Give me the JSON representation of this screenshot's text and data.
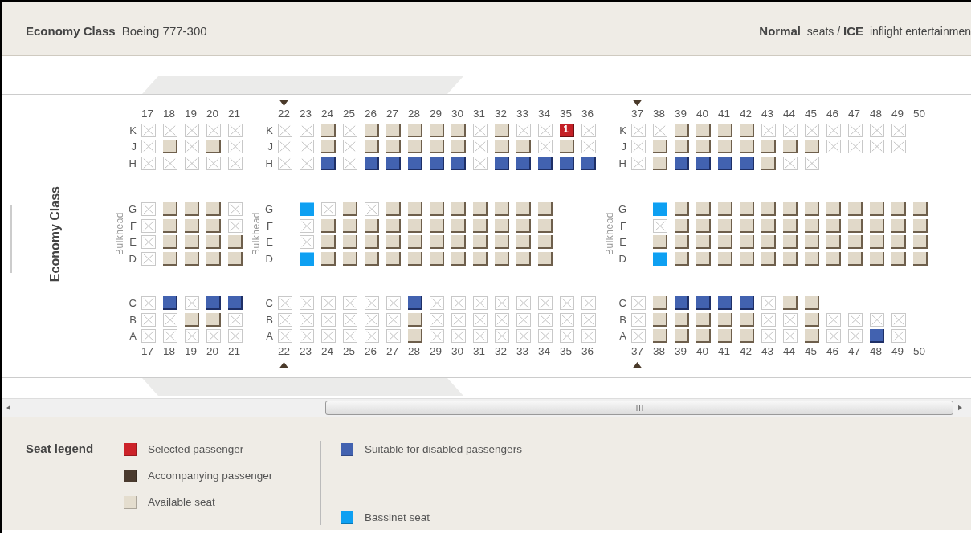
{
  "header": {
    "class_name": "Economy Class",
    "aircraft": "Boeing 777-300",
    "view_modes": "**Normal** seats / **ICE** inflight entertainmen"
  },
  "cabin_label": "Economy Class",
  "sections": [
    {
      "bulkhead": "Bulkhead",
      "top_numbers": [
        "17",
        "18",
        "19",
        "20",
        "21"
      ],
      "bottom_numbers": [
        "17",
        "18",
        "19",
        "20",
        "21"
      ],
      "groups": [
        [
          {
            "letter": "K",
            "seats": [
              {
                "kind": "taken"
              },
              {
                "kind": "taken"
              },
              {
                "kind": "taken"
              },
              {
                "kind": "taken"
              },
              {
                "kind": "taken"
              }
            ]
          },
          {
            "letter": "J",
            "seats": [
              {
                "kind": "taken"
              },
              {
                "kind": "free"
              },
              {
                "kind": "taken"
              },
              {
                "kind": "free"
              },
              {
                "kind": "taken"
              }
            ]
          },
          {
            "letter": "H",
            "seats": [
              {
                "kind": "taken"
              },
              {
                "kind": "taken"
              },
              {
                "kind": "taken"
              },
              {
                "kind": "taken"
              },
              {
                "kind": "taken"
              }
            ]
          }
        ],
        [
          {
            "letter": "G",
            "seats": [
              {
                "kind": "taken"
              },
              {
                "kind": "free"
              },
              {
                "kind": "free"
              },
              {
                "kind": "free"
              },
              {
                "kind": "taken"
              }
            ]
          },
          {
            "letter": "F",
            "seats": [
              {
                "kind": "taken"
              },
              {
                "kind": "free"
              },
              {
                "kind": "free"
              },
              {
                "kind": "free"
              },
              {
                "kind": "taken"
              }
            ]
          },
          {
            "letter": "E",
            "seats": [
              {
                "kind": "taken"
              },
              {
                "kind": "free"
              },
              {
                "kind": "free"
              },
              {
                "kind": "free"
              },
              {
                "kind": "free"
              }
            ]
          },
          {
            "letter": "D",
            "seats": [
              {
                "kind": "taken"
              },
              {
                "kind": "free"
              },
              {
                "kind": "free"
              },
              {
                "kind": "free"
              },
              {
                "kind": "free"
              }
            ]
          }
        ],
        [
          {
            "letter": "C",
            "seats": [
              {
                "kind": "taken"
              },
              {
                "kind": "disabled"
              },
              {
                "kind": "taken"
              },
              {
                "kind": "disabled"
              },
              {
                "kind": "disabled"
              }
            ]
          },
          {
            "letter": "B",
            "seats": [
              {
                "kind": "taken"
              },
              {
                "kind": "taken"
              },
              {
                "kind": "free"
              },
              {
                "kind": "free"
              },
              {
                "kind": "taken"
              }
            ]
          },
          {
            "letter": "A",
            "seats": [
              {
                "kind": "taken"
              },
              {
                "kind": "taken"
              },
              {
                "kind": "taken"
              },
              {
                "kind": "taken"
              },
              {
                "kind": "taken"
              }
            ]
          }
        ]
      ]
    },
    {
      "exit_markers": true,
      "bulkhead": "Bulkhead",
      "top_numbers": [
        "22",
        "23",
        "24",
        "25",
        "26",
        "27",
        "28",
        "29",
        "30",
        "31",
        "32",
        "33",
        "34",
        "35",
        "36"
      ],
      "bottom_numbers": [
        "22",
        "23",
        "24",
        "25",
        "26",
        "27",
        "28",
        "29",
        "30",
        "31",
        "32",
        "33",
        "34",
        "35",
        "36"
      ],
      "groups": [
        [
          {
            "letter": "K",
            "seats": [
              {
                "kind": "taken"
              },
              {
                "kind": "taken"
              },
              {
                "kind": "free"
              },
              {
                "kind": "taken"
              },
              {
                "kind": "free"
              },
              {
                "kind": "free"
              },
              {
                "kind": "free"
              },
              {
                "kind": "free"
              },
              {
                "kind": "free"
              },
              {
                "kind": "taken"
              },
              {
                "kind": "free"
              },
              {
                "kind": "taken"
              },
              {
                "kind": "taken"
              },
              {
                "kind": "selected",
                "label": "1"
              },
              {
                "kind": "taken"
              }
            ]
          },
          {
            "letter": "J",
            "seats": [
              {
                "kind": "taken"
              },
              {
                "kind": "taken"
              },
              {
                "kind": "free"
              },
              {
                "kind": "taken"
              },
              {
                "kind": "free"
              },
              {
                "kind": "free"
              },
              {
                "kind": "free"
              },
              {
                "kind": "free"
              },
              {
                "kind": "free"
              },
              {
                "kind": "taken"
              },
              {
                "kind": "free"
              },
              {
                "kind": "free"
              },
              {
                "kind": "taken"
              },
              {
                "kind": "free"
              },
              {
                "kind": "taken"
              }
            ]
          },
          {
            "letter": "H",
            "seats": [
              {
                "kind": "taken"
              },
              {
                "kind": "taken"
              },
              {
                "kind": "disabled"
              },
              {
                "kind": "taken"
              },
              {
                "kind": "disabled"
              },
              {
                "kind": "disabled"
              },
              {
                "kind": "disabled"
              },
              {
                "kind": "disabled"
              },
              {
                "kind": "disabled"
              },
              {
                "kind": "taken"
              },
              {
                "kind": "disabled"
              },
              {
                "kind": "disabled"
              },
              {
                "kind": "disabled"
              },
              {
                "kind": "disabled"
              },
              {
                "kind": "disabled"
              }
            ]
          }
        ],
        [
          {
            "letter": "G",
            "seats": [
              {
                "kind": "gap"
              },
              {
                "kind": "bassinet"
              },
              {
                "kind": "taken"
              },
              {
                "kind": "free"
              },
              {
                "kind": "taken"
              },
              {
                "kind": "free"
              },
              {
                "kind": "free"
              },
              {
                "kind": "free"
              },
              {
                "kind": "free"
              },
              {
                "kind": "free"
              },
              {
                "kind": "free"
              },
              {
                "kind": "free"
              },
              {
                "kind": "free"
              },
              {
                "kind": "gap"
              },
              {
                "kind": "gap"
              }
            ]
          },
          {
            "letter": "F",
            "seats": [
              {
                "kind": "gap"
              },
              {
                "kind": "taken"
              },
              {
                "kind": "free"
              },
              {
                "kind": "free"
              },
              {
                "kind": "free"
              },
              {
                "kind": "free"
              },
              {
                "kind": "free"
              },
              {
                "kind": "free"
              },
              {
                "kind": "free"
              },
              {
                "kind": "free"
              },
              {
                "kind": "free"
              },
              {
                "kind": "free"
              },
              {
                "kind": "free"
              },
              {
                "kind": "gap"
              },
              {
                "kind": "gap"
              }
            ]
          },
          {
            "letter": "E",
            "seats": [
              {
                "kind": "gap"
              },
              {
                "kind": "taken"
              },
              {
                "kind": "free"
              },
              {
                "kind": "free"
              },
              {
                "kind": "free"
              },
              {
                "kind": "free"
              },
              {
                "kind": "free"
              },
              {
                "kind": "free"
              },
              {
                "kind": "free"
              },
              {
                "kind": "free"
              },
              {
                "kind": "free"
              },
              {
                "kind": "free"
              },
              {
                "kind": "free"
              },
              {
                "kind": "gap"
              },
              {
                "kind": "gap"
              }
            ]
          },
          {
            "letter": "D",
            "seats": [
              {
                "kind": "gap"
              },
              {
                "kind": "bassinet"
              },
              {
                "kind": "free"
              },
              {
                "kind": "free"
              },
              {
                "kind": "free"
              },
              {
                "kind": "free"
              },
              {
                "kind": "free"
              },
              {
                "kind": "free"
              },
              {
                "kind": "free"
              },
              {
                "kind": "free"
              },
              {
                "kind": "free"
              },
              {
                "kind": "free"
              },
              {
                "kind": "free"
              },
              {
                "kind": "gap"
              },
              {
                "kind": "gap"
              }
            ]
          }
        ],
        [
          {
            "letter": "C",
            "seats": [
              {
                "kind": "taken"
              },
              {
                "kind": "taken"
              },
              {
                "kind": "taken"
              },
              {
                "kind": "taken"
              },
              {
                "kind": "taken"
              },
              {
                "kind": "taken"
              },
              {
                "kind": "disabled"
              },
              {
                "kind": "taken"
              },
              {
                "kind": "taken"
              },
              {
                "kind": "taken"
              },
              {
                "kind": "taken"
              },
              {
                "kind": "taken"
              },
              {
                "kind": "taken"
              },
              {
                "kind": "taken"
              },
              {
                "kind": "taken"
              }
            ]
          },
          {
            "letter": "B",
            "seats": [
              {
                "kind": "taken"
              },
              {
                "kind": "taken"
              },
              {
                "kind": "taken"
              },
              {
                "kind": "taken"
              },
              {
                "kind": "taken"
              },
              {
                "kind": "taken"
              },
              {
                "kind": "free"
              },
              {
                "kind": "taken"
              },
              {
                "kind": "taken"
              },
              {
                "kind": "taken"
              },
              {
                "kind": "taken"
              },
              {
                "kind": "taken"
              },
              {
                "kind": "taken"
              },
              {
                "kind": "taken"
              },
              {
                "kind": "taken"
              }
            ]
          },
          {
            "letter": "A",
            "seats": [
              {
                "kind": "taken"
              },
              {
                "kind": "taken"
              },
              {
                "kind": "taken"
              },
              {
                "kind": "taken"
              },
              {
                "kind": "taken"
              },
              {
                "kind": "taken"
              },
              {
                "kind": "free"
              },
              {
                "kind": "taken"
              },
              {
                "kind": "taken"
              },
              {
                "kind": "taken"
              },
              {
                "kind": "taken"
              },
              {
                "kind": "taken"
              },
              {
                "kind": "taken"
              },
              {
                "kind": "taken"
              },
              {
                "kind": "taken"
              }
            ]
          }
        ]
      ]
    },
    {
      "exit_markers": true,
      "bulkhead": "Bulkhead",
      "top_numbers": [
        "37",
        "38",
        "39",
        "40",
        "41",
        "42",
        "43",
        "44",
        "45",
        "46",
        "47",
        "48",
        "49",
        "50"
      ],
      "bottom_numbers": [
        "37",
        "38",
        "39",
        "40",
        "41",
        "42",
        "43",
        "44",
        "45",
        "46",
        "47",
        "48",
        "49",
        "50"
      ],
      "groups": [
        [
          {
            "letter": "K",
            "seats": [
              {
                "kind": "taken"
              },
              {
                "kind": "taken"
              },
              {
                "kind": "free"
              },
              {
                "kind": "free"
              },
              {
                "kind": "free"
              },
              {
                "kind": "free"
              },
              {
                "kind": "taken"
              },
              {
                "kind": "taken"
              },
              {
                "kind": "taken"
              },
              {
                "kind": "taken"
              },
              {
                "kind": "taken"
              },
              {
                "kind": "taken"
              },
              {
                "kind": "taken"
              },
              {
                "kind": "gap"
              }
            ]
          },
          {
            "letter": "J",
            "seats": [
              {
                "kind": "taken"
              },
              {
                "kind": "free"
              },
              {
                "kind": "free"
              },
              {
                "kind": "free"
              },
              {
                "kind": "free"
              },
              {
                "kind": "free"
              },
              {
                "kind": "free"
              },
              {
                "kind": "free"
              },
              {
                "kind": "free"
              },
              {
                "kind": "taken"
              },
              {
                "kind": "taken"
              },
              {
                "kind": "taken"
              },
              {
                "kind": "taken"
              },
              {
                "kind": "gap"
              }
            ]
          },
          {
            "letter": "H",
            "seats": [
              {
                "kind": "taken"
              },
              {
                "kind": "free"
              },
              {
                "kind": "disabled"
              },
              {
                "kind": "disabled"
              },
              {
                "kind": "disabled"
              },
              {
                "kind": "disabled"
              },
              {
                "kind": "free"
              },
              {
                "kind": "taken"
              },
              {
                "kind": "taken"
              },
              {
                "kind": "gap"
              },
              {
                "kind": "gap"
              },
              {
                "kind": "gap"
              },
              {
                "kind": "gap"
              },
              {
                "kind": "gap"
              }
            ]
          }
        ],
        [
          {
            "letter": "G",
            "seats": [
              {
                "kind": "gap"
              },
              {
                "kind": "bassinet"
              },
              {
                "kind": "free"
              },
              {
                "kind": "free"
              },
              {
                "kind": "free"
              },
              {
                "kind": "free"
              },
              {
                "kind": "free"
              },
              {
                "kind": "free"
              },
              {
                "kind": "free"
              },
              {
                "kind": "free"
              },
              {
                "kind": "free"
              },
              {
                "kind": "free"
              },
              {
                "kind": "free"
              },
              {
                "kind": "free"
              }
            ]
          },
          {
            "letter": "F",
            "seats": [
              {
                "kind": "gap"
              },
              {
                "kind": "taken"
              },
              {
                "kind": "free"
              },
              {
                "kind": "free"
              },
              {
                "kind": "free"
              },
              {
                "kind": "free"
              },
              {
                "kind": "free"
              },
              {
                "kind": "free"
              },
              {
                "kind": "free"
              },
              {
                "kind": "free"
              },
              {
                "kind": "free"
              },
              {
                "kind": "free"
              },
              {
                "kind": "free"
              },
              {
                "kind": "free"
              }
            ]
          },
          {
            "letter": "E",
            "seats": [
              {
                "kind": "gap"
              },
              {
                "kind": "free"
              },
              {
                "kind": "free"
              },
              {
                "kind": "free"
              },
              {
                "kind": "free"
              },
              {
                "kind": "free"
              },
              {
                "kind": "free"
              },
              {
                "kind": "free"
              },
              {
                "kind": "free"
              },
              {
                "kind": "free"
              },
              {
                "kind": "free"
              },
              {
                "kind": "free"
              },
              {
                "kind": "free"
              },
              {
                "kind": "free"
              }
            ]
          },
          {
            "letter": "D",
            "seats": [
              {
                "kind": "gap"
              },
              {
                "kind": "bassinet"
              },
              {
                "kind": "free"
              },
              {
                "kind": "free"
              },
              {
                "kind": "free"
              },
              {
                "kind": "free"
              },
              {
                "kind": "free"
              },
              {
                "kind": "free"
              },
              {
                "kind": "free"
              },
              {
                "kind": "free"
              },
              {
                "kind": "free"
              },
              {
                "kind": "free"
              },
              {
                "kind": "free"
              },
              {
                "kind": "free"
              }
            ]
          }
        ],
        [
          {
            "letter": "C",
            "seats": [
              {
                "kind": "taken"
              },
              {
                "kind": "free"
              },
              {
                "kind": "disabled"
              },
              {
                "kind": "disabled"
              },
              {
                "kind": "disabled"
              },
              {
                "kind": "disabled"
              },
              {
                "kind": "taken"
              },
              {
                "kind": "free"
              },
              {
                "kind": "free"
              },
              {
                "kind": "gap"
              },
              {
                "kind": "gap"
              },
              {
                "kind": "gap"
              },
              {
                "kind": "gap"
              },
              {
                "kind": "gap"
              }
            ]
          },
          {
            "letter": "B",
            "seats": [
              {
                "kind": "taken"
              },
              {
                "kind": "free"
              },
              {
                "kind": "free"
              },
              {
                "kind": "free"
              },
              {
                "kind": "free"
              },
              {
                "kind": "free"
              },
              {
                "kind": "taken"
              },
              {
                "kind": "taken"
              },
              {
                "kind": "free"
              },
              {
                "kind": "taken"
              },
              {
                "kind": "taken"
              },
              {
                "kind": "taken"
              },
              {
                "kind": "taken"
              },
              {
                "kind": "gap"
              }
            ]
          },
          {
            "letter": "A",
            "seats": [
              {
                "kind": "taken"
              },
              {
                "kind": "free"
              },
              {
                "kind": "free"
              },
              {
                "kind": "free"
              },
              {
                "kind": "free"
              },
              {
                "kind": "free"
              },
              {
                "kind": "taken"
              },
              {
                "kind": "taken"
              },
              {
                "kind": "free"
              },
              {
                "kind": "taken"
              },
              {
                "kind": "taken"
              },
              {
                "kind": "disabled"
              },
              {
                "kind": "taken"
              },
              {
                "kind": "gap"
              }
            ]
          }
        ]
      ]
    }
  ],
  "legend": {
    "title": "Seat legend",
    "columns": [
      [
        {
          "label": "Selected passenger",
          "color": "#cc2229"
        },
        {
          "label": "Accompanying passenger",
          "color": "#4a3a2e"
        },
        {
          "label": "Available seat",
          "color": "#e4ddce"
        }
      ],
      [
        {
          "label": "Suitable for disabled passengers",
          "color": "#4262b0"
        },
        {
          "label": "Bassinet seat",
          "color": "#0ea0f2"
        }
      ]
    ]
  }
}
